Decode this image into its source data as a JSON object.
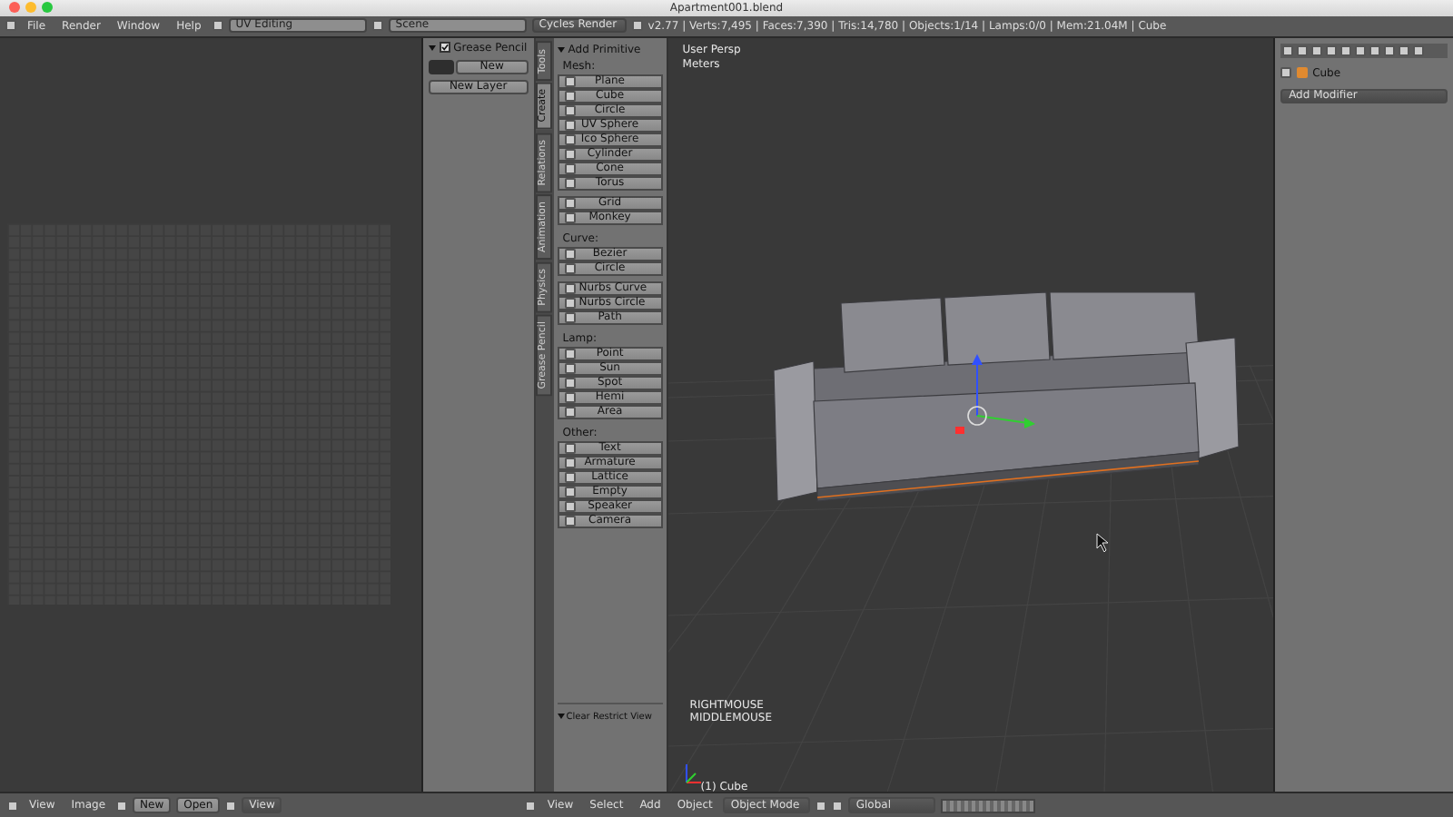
{
  "window": {
    "title": "Apartment001.blend"
  },
  "header": {
    "menus": [
      "File",
      "Render",
      "Window",
      "Help"
    ],
    "screen_layout": "UV Editing",
    "scene": "Scene",
    "render_engine": "Cycles Render",
    "stats": "v2.77 | Verts:7,495 | Faces:7,390 | Tris:14,780 | Objects:1/14 | Lamps:0/0 | Mem:21.04M | Cube"
  },
  "grease_pencil": {
    "title": "Grease Pencil",
    "checked": true,
    "new_button": "New",
    "new_layer_button": "New Layer"
  },
  "tool_tabs": [
    {
      "label": "Tools",
      "selected": false
    },
    {
      "label": "Create",
      "selected": true
    },
    {
      "label": "Relations",
      "selected": false
    },
    {
      "label": "Animation",
      "selected": false
    },
    {
      "label": "Physics",
      "selected": false
    },
    {
      "label": "Grease Pencil",
      "selected": false
    }
  ],
  "tool_shelf": {
    "title": "Add Primitive",
    "groups": [
      {
        "label": "Mesh:",
        "blocks": [
          [
            "Plane",
            "Cube",
            "Circle",
            "UV Sphere",
            "Ico Sphere",
            "Cylinder",
            "Cone",
            "Torus"
          ],
          [
            "Grid",
            "Monkey"
          ]
        ]
      },
      {
        "label": "Curve:",
        "blocks": [
          [
            "Bezier",
            "Circle"
          ],
          [
            "Nurbs Curve",
            "Nurbs Circle",
            "Path"
          ]
        ]
      },
      {
        "label": "Lamp:",
        "blocks": [
          [
            "Point",
            "Sun",
            "Spot",
            "Hemi",
            "Area"
          ]
        ]
      },
      {
        "label": "Other:",
        "blocks": [
          [
            "Text",
            "Armature",
            "Lattice",
            "Empty",
            "Speaker",
            "Camera"
          ]
        ]
      }
    ],
    "bottom_panel": "Clear Restrict View"
  },
  "viewport": {
    "view_name": "User Persp",
    "units": "Meters",
    "key_hints": [
      "RIGHTMOUSE",
      "MIDDLEMOUSE"
    ],
    "object_label": "(1) Cube",
    "menus": [
      "View",
      "Select",
      "Add",
      "Object"
    ],
    "mode": "Object Mode",
    "orientation": "Global"
  },
  "image_editor": {
    "menus": [
      "View",
      "Image"
    ],
    "new_button": "New",
    "open_button": "Open",
    "view_menu": "View"
  },
  "properties": {
    "object_name": "Cube",
    "add_modifier": "Add Modifier"
  }
}
